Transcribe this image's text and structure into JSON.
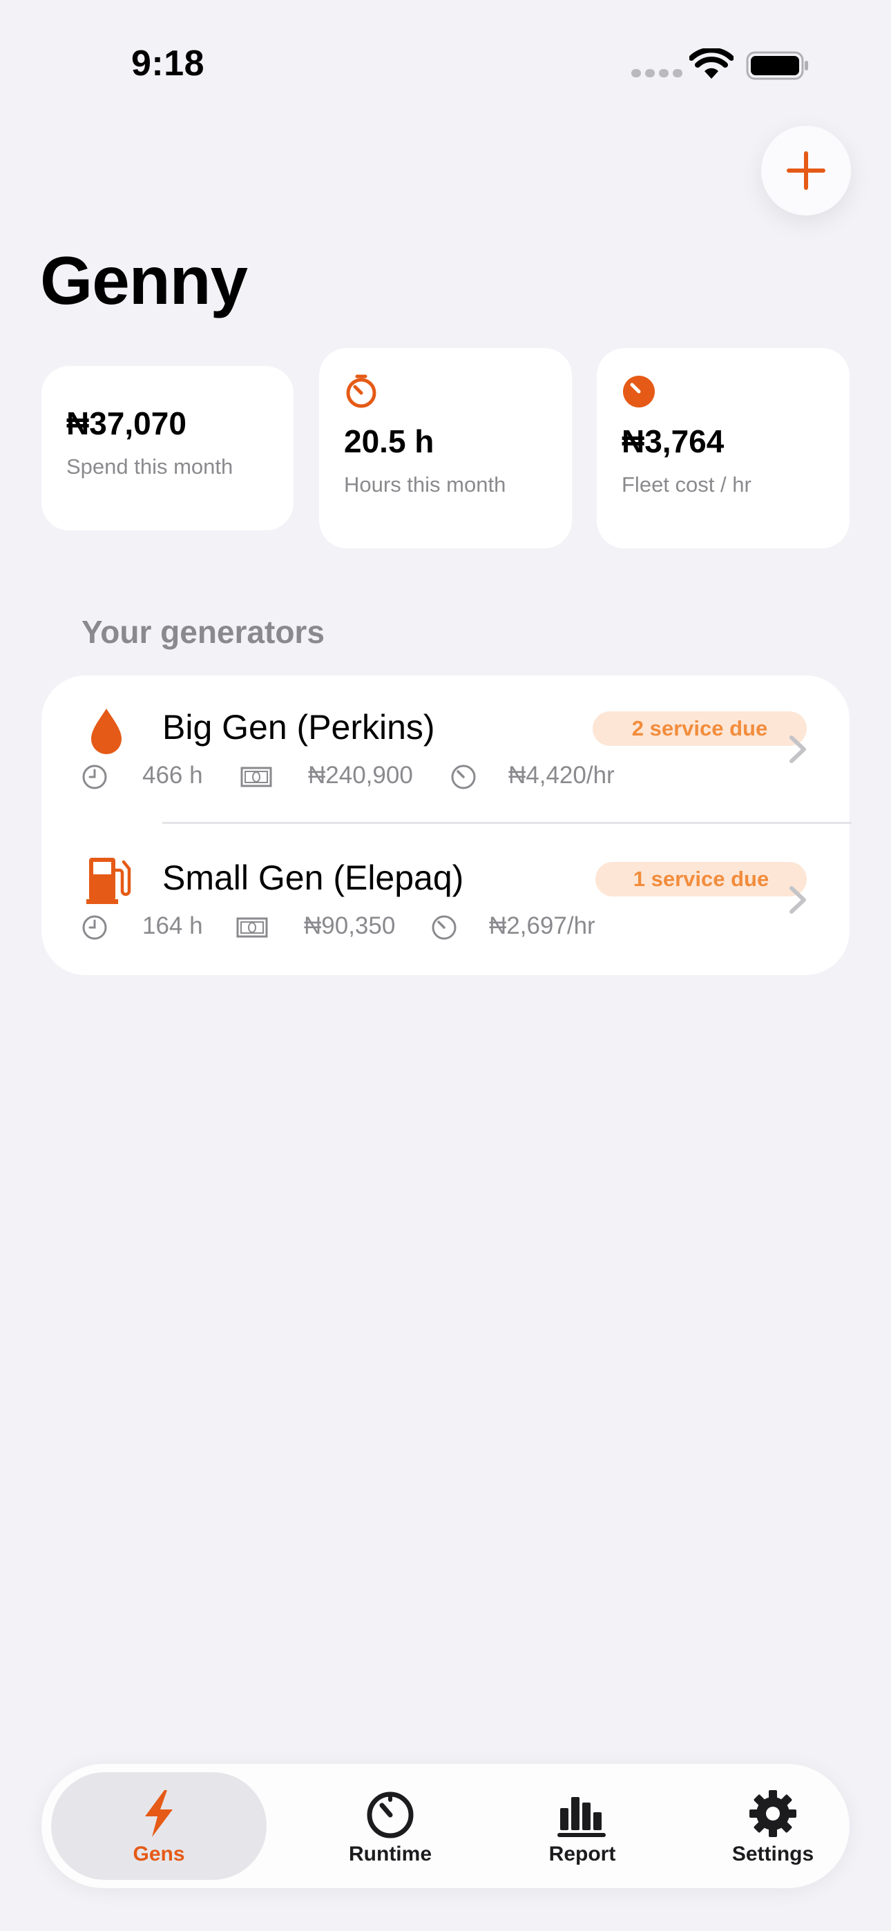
{
  "status_bar": {
    "time": "9:18"
  },
  "header": {
    "title": "Genny",
    "add_icon": "plus-icon"
  },
  "stats": [
    {
      "value": "₦37,070",
      "label": "Spend this month"
    },
    {
      "value": "20.5 h",
      "label": "Hours this month",
      "icon": "timer-icon"
    },
    {
      "value": "₦3,764",
      "label": "Fleet cost / hr",
      "icon": "gauge-icon"
    }
  ],
  "section": {
    "title": "Your generators"
  },
  "generators": [
    {
      "name": "Big Gen (Perkins)",
      "icon": "drop-icon",
      "badge": "2 service due",
      "hours": "466 h",
      "cost": "₦240,900",
      "rate": "₦4,420/hr"
    },
    {
      "name": "Small Gen (Elepaq)",
      "icon": "fuel-pump-icon",
      "badge": "1 service due",
      "hours": "164 h",
      "cost": "₦90,350",
      "rate": "₦2,697/hr"
    }
  ],
  "tabs": [
    {
      "label": "Gens",
      "icon": "bolt-icon",
      "active": true
    },
    {
      "label": "Runtime",
      "icon": "timer-icon",
      "active": false
    },
    {
      "label": "Report",
      "icon": "chart-bars-icon",
      "active": false
    },
    {
      "label": "Settings",
      "icon": "gear-icon",
      "active": false
    }
  ],
  "colors": {
    "accent": "#e55a16",
    "badge_bg": "#fde6d6",
    "badge_text": "#f28c3c",
    "background": "#f2f2f7"
  }
}
